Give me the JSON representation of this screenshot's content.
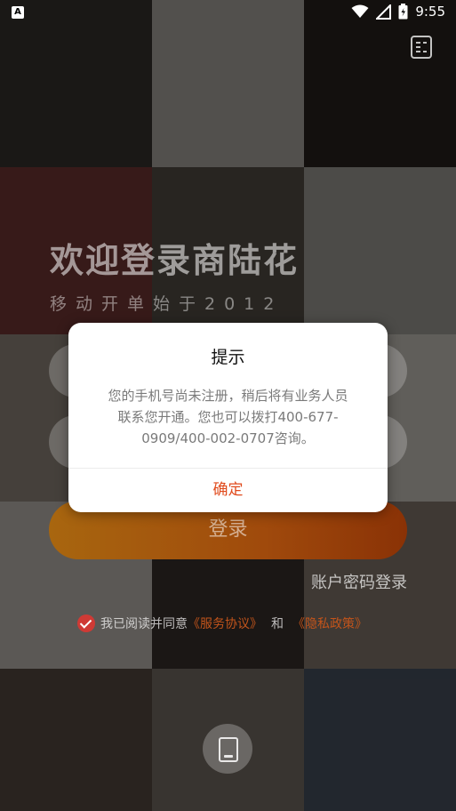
{
  "status_bar": {
    "time": "9:55",
    "left_badge": "A"
  },
  "header": {
    "menu_icon": "list-icon"
  },
  "welcome": {
    "title": "欢迎登录商陆花",
    "slogan": "移动开单始于2012"
  },
  "form": {
    "login_label": "登录",
    "alt_login_label": "账户密码登录"
  },
  "agreement": {
    "prefix": "我已阅读并同意",
    "service_link": "《服务协议》",
    "and": "和",
    "privacy_link": "《隐私政策》"
  },
  "fab": {
    "icon": "phone-icon"
  },
  "dialog": {
    "title": "提示",
    "message": "您的手机号尚未注册，稍后将有业务人员联系您开通。您也可以拨打400-677-0909/400-002-0707咨询。",
    "confirm_label": "确定"
  },
  "colors": {
    "accent": "#e04a1c",
    "check": "#cf3a35",
    "login_gradient_start": "#a8660f",
    "login_gradient_end": "#8a3206"
  }
}
